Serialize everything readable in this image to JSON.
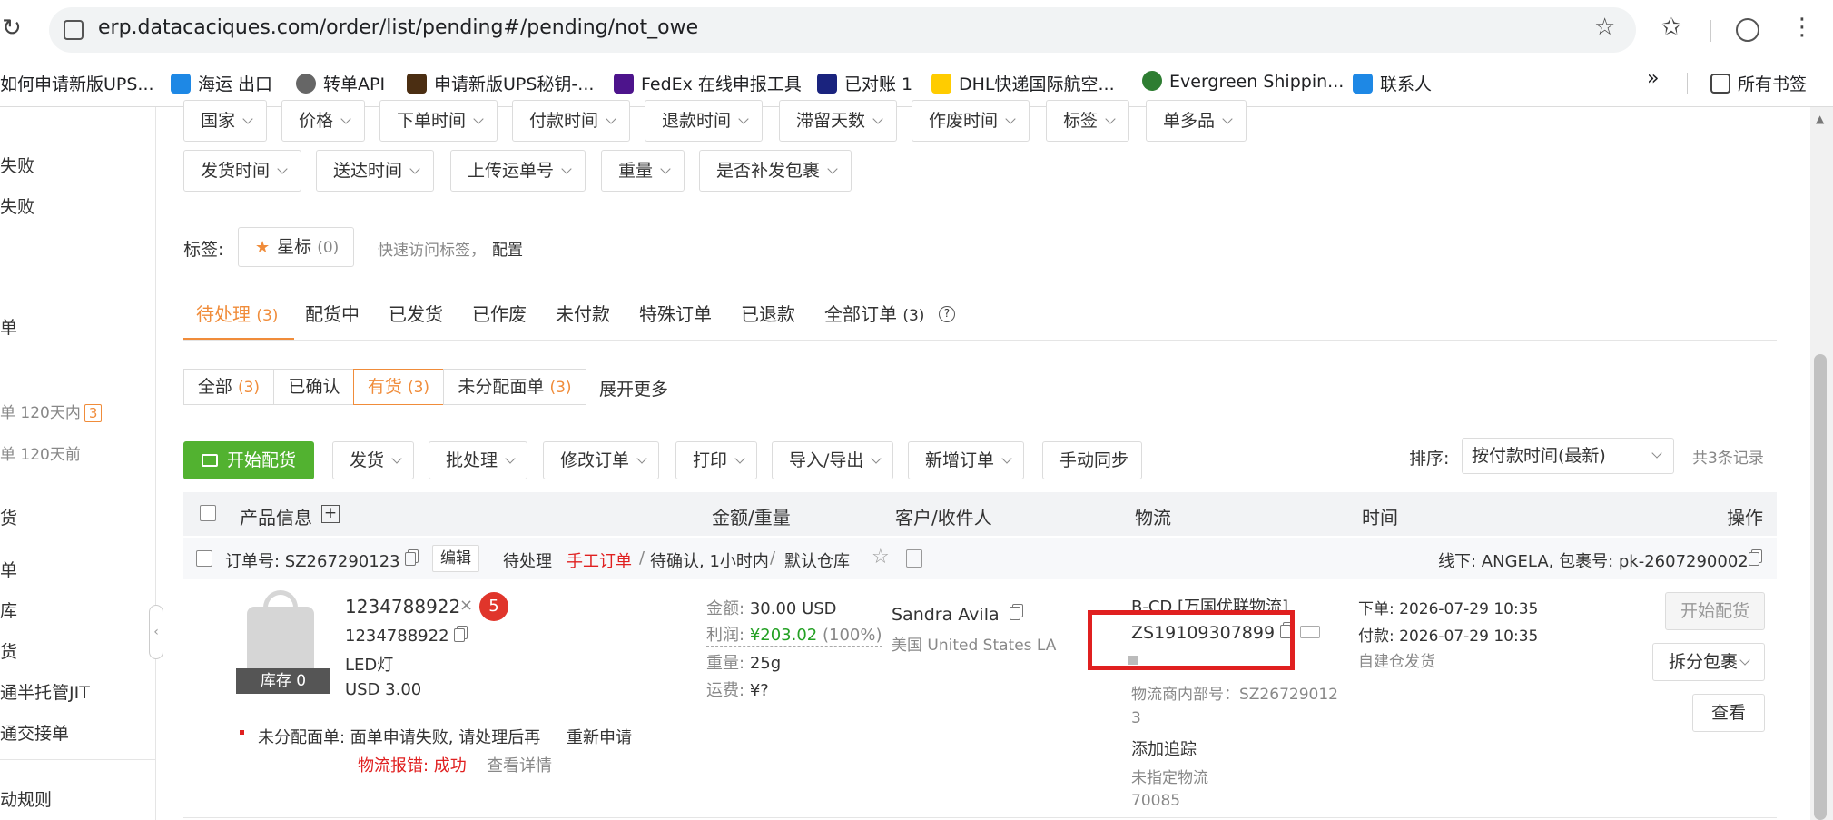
{
  "browser": {
    "url": "erp.datacaciques.com/order/list/pending#/pending/not_owe",
    "bookmarks": [
      "如何申请新版UPS...",
      "海运 出口",
      "转单API",
      "申请新版UPS秘钥-...",
      "FedEx 在线申报工具",
      "已对账 1",
      "DHL快递国际航空...",
      "Evergreen Shippin...",
      "联系人"
    ],
    "all_bookmarks": "所有书签",
    "more_label": "»"
  },
  "sidebar": {
    "items": [
      "失败",
      "失败",
      "单",
      "单 120天内",
      "3",
      "单 120天前",
      "货",
      "单",
      "库",
      "货",
      "通半托管JIT",
      "通交接单",
      "动规则"
    ]
  },
  "filters": {
    "row1": [
      "国家",
      "价格",
      "下单时间",
      "付款时间",
      "退款时间",
      "滞留天数",
      "作废时间",
      "标签",
      "单多品"
    ],
    "row2": [
      "发货时间",
      "送达时间",
      "上传运单号",
      "重量",
      "是否补发包裹"
    ]
  },
  "tags": {
    "label": "标签:",
    "star_label": "星标",
    "star_count": "(0)",
    "quick_hint": "快速访问标签，",
    "config_link": "配置"
  },
  "tabs": [
    {
      "label": "待处理",
      "count": "(3)"
    },
    {
      "label": "配货中",
      "count": ""
    },
    {
      "label": "已发货",
      "count": ""
    },
    {
      "label": "已作废",
      "count": ""
    },
    {
      "label": "未付款",
      "count": ""
    },
    {
      "label": "特殊订单",
      "count": ""
    },
    {
      "label": "已退款",
      "count": ""
    },
    {
      "label": "全部订单",
      "count": "(3)"
    }
  ],
  "subfilters": [
    {
      "label": "全部",
      "count": "(3)"
    },
    {
      "label": "已确认",
      "count": ""
    },
    {
      "label": "有货",
      "count": "(3)"
    },
    {
      "label": "未分配面单",
      "count": "(3)"
    }
  ],
  "expand_more": "展开更多",
  "toolbar": {
    "start_picking": "开始配货",
    "buttons": [
      "发货",
      "批处理",
      "修改订单",
      "打印",
      "导入/导出",
      "新增订单"
    ],
    "sync": "手动同步",
    "sort_label": "排序:",
    "sort_value": "按付款时间(最新)",
    "total": "共3条记录"
  },
  "table": {
    "headers": [
      "产品信息",
      "金额/重量",
      "客户/收件人",
      "物流",
      "时间",
      "操作"
    ]
  },
  "order": {
    "order_no": "订单号: SZ267290123",
    "edit": "编辑",
    "status": "待处理",
    "manual": "手工订单",
    "sep1": "/",
    "confirm_state": "待确认, 1小时内",
    "sep2": "/",
    "warehouse": "默认仓库",
    "offline": "线下: ANGELA, 包裹号: pk-2607290002",
    "product": {
      "title": "1234788922",
      "qty_badge": "5",
      "times": "×",
      "sku": "1234788922",
      "name": "LED灯",
      "price": "USD 3.00",
      "stock": "库存 0"
    },
    "amount": {
      "label": "金额:",
      "value": "30.00 USD"
    },
    "profit": {
      "label": "利润:",
      "value": "¥203.02",
      "pct": "(100%)"
    },
    "weight": {
      "label": "重量:",
      "value": "25g"
    },
    "freight": {
      "label": "运费:",
      "value": "¥?"
    },
    "customer": {
      "name": "Sandra Avila",
      "country": "美国 United States LA"
    },
    "logistics": {
      "carrier": "B-CD [万国优联物流]",
      "tracking": "ZS19109307899",
      "internal_label": "物流商内部号：SZ26729012",
      "internal_cont": "3",
      "add_track": "添加追踪",
      "unassigned": "未指定物流",
      "code": "70085"
    },
    "times": {
      "order_time": "下单: 2026-07-29 10:35",
      "pay_time": "付款: 2026-07-29 10:35",
      "ship_type": "自建仓发货"
    },
    "actions": {
      "start": "开始配货",
      "split": "拆分包裹",
      "view": "查看"
    },
    "error": {
      "unassigned_label": "未分配面单: 面单申请失败, 请处理后再",
      "reapply": "重新申请",
      "log_error": "物流报错: 成功",
      "view_detail": "查看详情"
    }
  },
  "colors": {
    "accent": "#f08c3a",
    "primary_button": "#52b230",
    "highlight_box": "#e02020"
  }
}
